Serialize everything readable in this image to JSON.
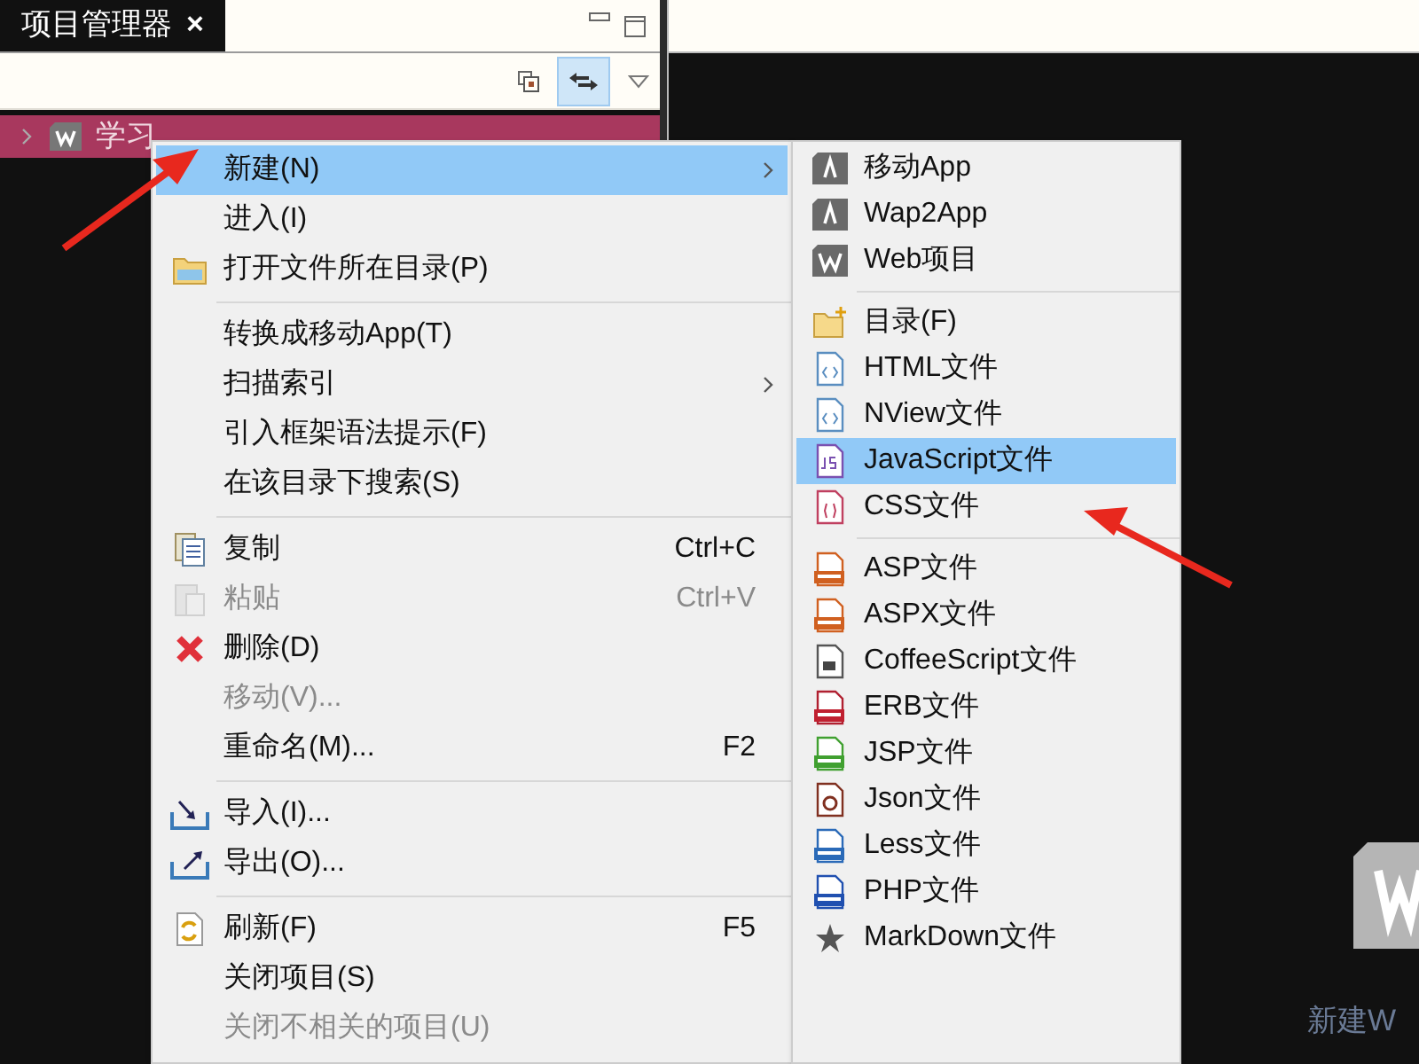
{
  "panel": {
    "tab": {
      "title": "项目管理器",
      "close": "×"
    }
  },
  "tree": {
    "items": [
      {
        "label": "学习",
        "selected": true,
        "expanded": false
      }
    ]
  },
  "context_menu": {
    "groups": [
      [
        {
          "label": "新建(N)",
          "selected": true,
          "disabled": false,
          "submenu": true
        },
        {
          "label": "进入(I)",
          "selected": false,
          "disabled": false,
          "submenu": false
        },
        {
          "label": "打开文件所在目录(P)",
          "selected": false,
          "disabled": false,
          "submenu": false
        }
      ],
      [
        {
          "label": "转换成移动App(T)",
          "selected": false,
          "disabled": false,
          "submenu": false
        },
        {
          "label": "扫描索引",
          "selected": false,
          "disabled": false,
          "submenu": true
        },
        {
          "label": "引入框架语法提示(F)",
          "selected": false,
          "disabled": false,
          "submenu": false
        },
        {
          "label": "在该目录下搜索(S)",
          "selected": false,
          "disabled": false,
          "submenu": false
        }
      ],
      [
        {
          "label": "复制",
          "shortcut": "Ctrl+C",
          "selected": false,
          "disabled": false,
          "submenu": false
        },
        {
          "label": "粘贴",
          "shortcut": "Ctrl+V",
          "selected": false,
          "disabled": true,
          "submenu": false
        },
        {
          "label": "删除(D)",
          "selected": false,
          "disabled": false,
          "submenu": false
        },
        {
          "label": "移动(V)...",
          "selected": false,
          "disabled": true,
          "submenu": false
        },
        {
          "label": "重命名(M)...",
          "shortcut": "F2",
          "selected": false,
          "disabled": false,
          "submenu": false
        }
      ],
      [
        {
          "label": "导入(I)...",
          "selected": false,
          "disabled": false,
          "submenu": false
        },
        {
          "label": "导出(O)...",
          "selected": false,
          "disabled": false,
          "submenu": false
        }
      ],
      [
        {
          "label": "刷新(F)",
          "shortcut": "F5",
          "selected": false,
          "disabled": false,
          "submenu": false
        },
        {
          "label": "关闭项目(S)",
          "selected": false,
          "disabled": false,
          "submenu": false
        },
        {
          "label": "关闭不相关的项目(U)",
          "selected": false,
          "disabled": true,
          "submenu": false
        }
      ]
    ]
  },
  "submenu": {
    "groups": [
      [
        {
          "label": "移动App",
          "selected": false
        },
        {
          "label": "Wap2App",
          "selected": false
        },
        {
          "label": "Web项目",
          "selected": false
        }
      ],
      [
        {
          "label": "目录(F)",
          "selected": false
        },
        {
          "label": "HTML文件",
          "selected": false
        },
        {
          "label": "NView文件",
          "selected": false
        },
        {
          "label": "JavaScript文件",
          "selected": true
        },
        {
          "label": "CSS文件",
          "selected": false
        }
      ],
      [
        {
          "label": "ASP文件",
          "selected": false
        },
        {
          "label": "ASPX文件",
          "selected": false
        },
        {
          "label": "CoffeeScript文件",
          "selected": false
        },
        {
          "label": "ERB文件",
          "selected": false
        },
        {
          "label": "JSP文件",
          "selected": false
        },
        {
          "label": "Json文件",
          "selected": false
        },
        {
          "label": "Less文件",
          "selected": false
        },
        {
          "label": "PHP文件",
          "selected": false
        },
        {
          "label": "MarkDown文件",
          "selected": false
        }
      ]
    ]
  },
  "editor": {
    "caption": "新建W"
  }
}
